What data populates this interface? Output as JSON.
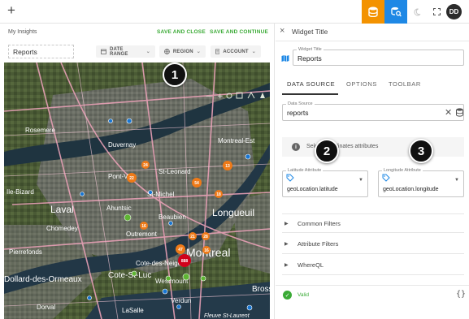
{
  "topbar": {
    "add_icon": "+",
    "buttons": [
      {
        "name": "database-icon",
        "active": true,
        "color": "#f39200"
      },
      {
        "name": "search-data-icon",
        "active": true,
        "color": "#1e88e5"
      },
      {
        "name": "moon-icon"
      },
      {
        "name": "fullscreen-icon"
      }
    ],
    "avatar_initials": "DD"
  },
  "left": {
    "insights_label": "My Insights",
    "save_and_close": "SAVE AND CLOSE",
    "save_and_continue": "SAVE AND CONTINUE",
    "title_value": "Reports",
    "filters": [
      {
        "label": "DATE RANGE",
        "icon": "calendar-icon"
      },
      {
        "label": "REGION",
        "icon": "globe-icon"
      },
      {
        "label": "ACCOUNT",
        "icon": "document-icon"
      }
    ]
  },
  "map": {
    "place_labels": [
      "Rosemere",
      "Montreal-Est",
      "Laval",
      "Chomedey",
      "Pont-Viau",
      "St-Leonard",
      "St-Michel",
      "Ahuntsic",
      "Beaubien",
      "Longueuil",
      "Montreal",
      "Westmount",
      "Outremont",
      "Cote-des-Neiges",
      "Verdun",
      "LaSalle",
      "Dorval",
      "Pierrefonds",
      "Fleuve St-Laurent",
      "Brossard",
      "Dollard-des-Ormeaux",
      "Cote-St-Luc",
      "Ile-Bizard",
      "Duvernay"
    ],
    "clusters": [
      "13",
      "22",
      "24",
      "54",
      "18",
      "16",
      "21",
      "16",
      "47",
      "888",
      "28"
    ],
    "colors": {
      "cluster_orange": "#ef7a18",
      "cluster_red": "#d0021b",
      "point_blue": "#1976d2",
      "point_green": "#5fb534"
    }
  },
  "callouts": [
    "1",
    "2",
    "3"
  ],
  "right": {
    "close_icon": "×",
    "header_title": "Widget Title",
    "widget_title_label": "Widget Title",
    "widget_title_value": "Reports",
    "tabs": [
      "DATA SOURCE",
      "OPTIONS",
      "TOOLBAR"
    ],
    "active_tab": "DATA SOURCE",
    "data_source_label": "Data Source",
    "data_source_value": "reports",
    "info_text": "Select coordinates attributes",
    "latitude_label": "Latitude Attribute",
    "latitude_value": "geoLocation.latitude",
    "longitude_label": "Longitude Attribute",
    "longitude_value": "geoLocation.longitude",
    "sections": [
      "Common Filters",
      "Attribute Filters",
      "WhereQL"
    ],
    "status_text": "Valid",
    "json_icon": "{}"
  }
}
